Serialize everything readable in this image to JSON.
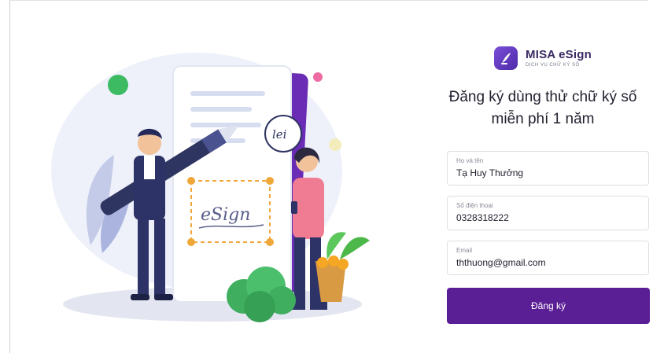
{
  "brand": {
    "name": "MISA eSign",
    "tagline": "DỊCH VỤ CHỮ KÝ SỐ",
    "color": "#5a1f95"
  },
  "illustration": {
    "speech_bubble_text": "lei",
    "document_signature_text": "eSign"
  },
  "form": {
    "title_line1": "Đăng ký dùng thử chữ ký số",
    "title_line2": "miễn phí 1 năm",
    "fields": [
      {
        "label": "Họ và tên",
        "value": "Tạ Huy Thưởng"
      },
      {
        "label": "Số điện thoại",
        "value": "0328318222"
      },
      {
        "label": "Email",
        "value": "ththuong@gmail.com"
      }
    ],
    "submit_label": "Đăng ký"
  }
}
